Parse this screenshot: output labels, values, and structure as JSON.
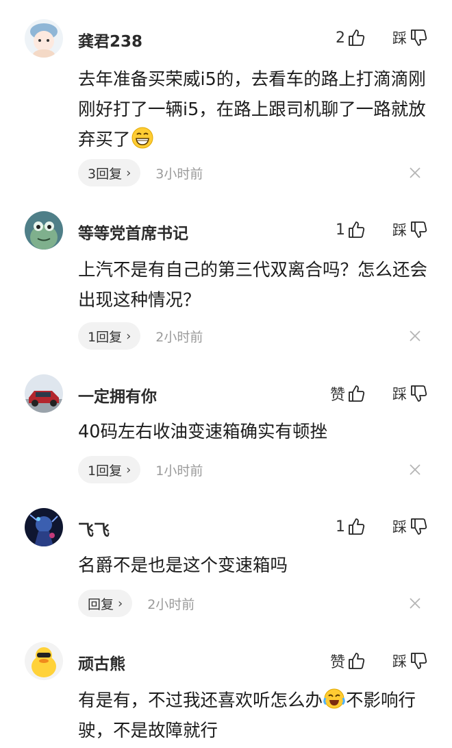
{
  "comments": [
    {
      "username": "龚君238",
      "like_count": "2",
      "dislike_label": "踩",
      "text": "去年准备买荣威i5的，去看车的路上打滴滴刚刚好打了一辆i5，在路上跟司机聊了一路就放弃买了",
      "emoji": "grin-emoji",
      "reply_label": "3回复",
      "time": "3小时前",
      "avatar": "cartoon-girl-avatar"
    },
    {
      "username": "等等党首席书记",
      "like_count": "1",
      "dislike_label": "踩",
      "text": "上汽不是有自己的第三代双离合吗？怎么还会出现这种情况？",
      "reply_label": "1回复",
      "time": "2小时前",
      "avatar": "green-frog-avatar"
    },
    {
      "username": "一定拥有你",
      "like_count": "赞",
      "dislike_label": "踩",
      "text": "40码左右收油变速箱确实有顿挫",
      "reply_label": "1回复",
      "time": "1小时前",
      "avatar": "red-suv-avatar"
    },
    {
      "username": "飞飞",
      "like_count": "1",
      "dislike_label": "踩",
      "text": "名爵不是也是这个变速箱吗",
      "reply_label": "回复",
      "time": "2小时前",
      "avatar": "blue-warrior-avatar"
    },
    {
      "username": "顽古熊",
      "like_count": "赞",
      "dislike_label": "踩",
      "text_before_emoji": "有是有，不过我还喜欢听怎么办",
      "text_after_emoji": "不影响行驶，不是故障就行",
      "emoji": "laugh-tears-emoji",
      "avatar": "yellow-duck-avatar"
    }
  ]
}
